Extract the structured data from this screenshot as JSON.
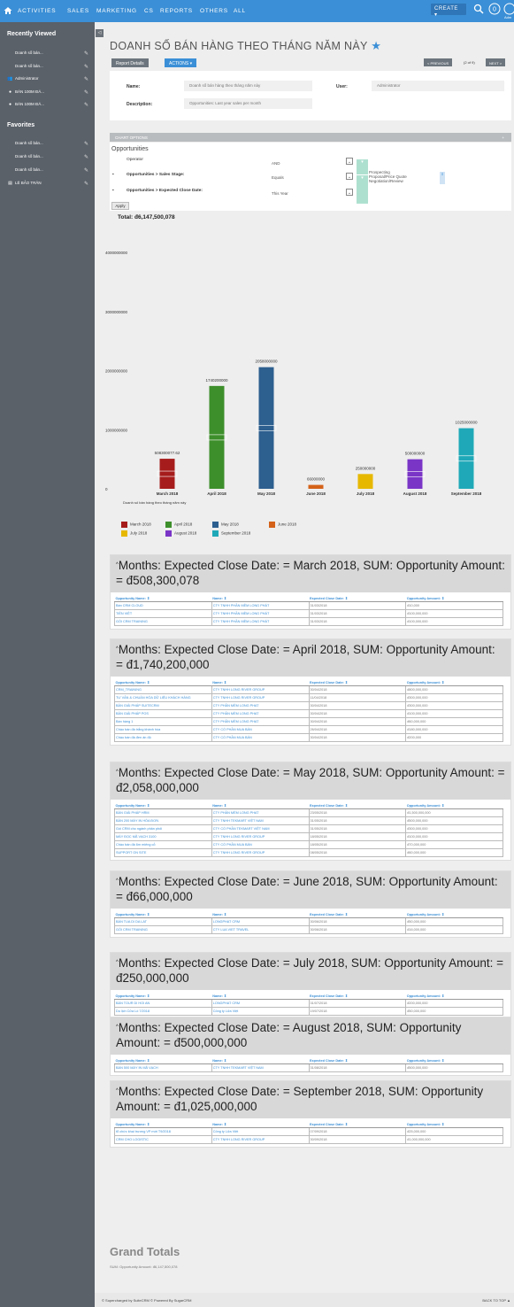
{
  "nav": {
    "items": [
      "ACTIVITIES",
      "SALES",
      "MARKETING",
      "CS",
      "REPORTS",
      "OTHERS",
      "ALL"
    ],
    "create_label": "CREATE ▾",
    "admin_label": "Adm"
  },
  "sidebar": {
    "recent_title": "Recently Viewed",
    "recent_items": [
      {
        "icon": "",
        "label": "Doanh số bán..."
      },
      {
        "icon": "",
        "label": "Doanh số bán..."
      },
      {
        "icon": "users",
        "label": "Administrator"
      },
      {
        "icon": "bulb",
        "label": "BÁN 100M ĐÁ..."
      },
      {
        "icon": "bulb",
        "label": "BÁN 100M ĐÁ..."
      }
    ],
    "fav_title": "Favorites",
    "fav_items": [
      {
        "icon": "",
        "label": "Doanh số bán..."
      },
      {
        "icon": "",
        "label": "Doanh số bán..."
      },
      {
        "icon": "",
        "label": "Doanh số bán..."
      },
      {
        "icon": "contact",
        "label": "LÊ BẢO TRÂN"
      }
    ]
  },
  "page": {
    "title": "DOANH SỐ BÁN HÀNG THEO THÁNG NĂM NÀY",
    "tab_report_details": "Report Details",
    "tab_actions": "ACTIONS ▾",
    "prev_label": "< PREVIOUS",
    "pager": "(2 of 9)",
    "next_label": "NEXT >",
    "name_label": "Name:",
    "name_value": "Doanh số bán hàng theo tháng năm này",
    "user_label": "User:",
    "user_value": "Administrator",
    "desc_label": "Description:",
    "desc_value": "Opportunities: Last year sales per month",
    "chart_options": "CHART OPTIONS",
    "chart_options_toggle": "+",
    "module": "Opportunities",
    "operator_label": "Operator",
    "operator_value": "AND",
    "cond1_label": "Opportunities > Sales Stage:",
    "cond1_op": "Equals",
    "cond1_values": [
      "Prospecting",
      "Proposal/Price Quote",
      "Negotiation/Review"
    ],
    "cond2_label": "Opportunities > Expected Close Date:",
    "cond2_op": "This Year",
    "apply": "Apply",
    "total": "Total: đ6,147,500,078"
  },
  "chart_data": {
    "type": "bar",
    "categories": [
      "March 2018",
      "April 2018",
      "May 2018",
      "June 2018",
      "July 2018",
      "August 2018",
      "September 2018"
    ],
    "values": [
      508300077.62,
      1740200000,
      2058000000,
      66000000,
      250000000,
      500000000,
      1025000000
    ],
    "value_labels": [
      "508300077.62",
      "1740200000",
      "2058000000",
      "66000000",
      "250000000",
      "500000000",
      "1025000000"
    ],
    "colors": [
      "#a61c1c",
      "#3d8f2b",
      "#2d5f8f",
      "#d4621a",
      "#e6b800",
      "#7a35c7",
      "#1fa9b8"
    ],
    "y_tick_labels": [
      "0",
      "1000000000",
      "2000000000",
      "3000000000",
      "4000000000"
    ],
    "y_ticks": [
      0,
      1000000000,
      2000000000,
      3000000000,
      4000000000
    ],
    "ylim": [
      0,
      4300000000
    ],
    "xlabel": "Doanh số bán hàng theo tháng năm này",
    "legend": [
      "March 2018",
      "April 2018",
      "May 2018",
      "June 2018",
      "July 2018",
      "August 2018",
      "September 2018"
    ]
  },
  "groups": [
    {
      "heading": "Months: Expected Close Date: = March 2018, SUM: Opportunity Amount: = đ508,300,078",
      "columns": [
        "Opportunity Name: ⇕",
        "Name: ⇕",
        "Expected Close Date: ⇕",
        "Opportunity Amount: ⇕"
      ],
      "rows": [
        [
          "Bán CRM CLOUD",
          "CTY TNHH PHẦN MỀM LONG PHÁT",
          "31/03/2018",
          "đ10,000"
        ],
        [
          "TIỀN VIỆT",
          "CTY TNHH PHẦN MỀM LONG PHÁT",
          "31/03/2018",
          "đ100,000,000"
        ],
        [
          "GÓI CRM TRAINING",
          "CTY TNHH PHẦN MỀM LONG PHÁT",
          "31/03/2018",
          "đ100,000,000"
        ]
      ]
    },
    {
      "heading": "Months: Expected Close Date: = April 2018, SUM: Opportunity Amount: = đ1,740,200,000",
      "columns": [
        "Opportunity Name: ⇕",
        "Name: ⇕",
        "Expected Close Date: ⇕",
        "Opportunity Amount: ⇕"
      ],
      "rows": [
        [
          "CRM_TRAINING",
          "CTY TNHH LONG RIVER GROUP",
          "30/04/2018",
          "đ800,000,000"
        ],
        [
          "TƯ VẤN & CHUẨN HÓA DỮ LIỆU KHÁCH HÀNG",
          "CTY TNHH LONG RIVER GROUP",
          "11/04/2018",
          "đ300,000,000"
        ],
        [
          "BẢN GIẢI PHÁP SUITECRM",
          "CTY PHẦN MỀM LONG PHAT",
          "30/04/2018",
          "đ300,000,000"
        ],
        [
          "BẢN GIẢI PHÁP POS",
          "CTY PHẦN MỀM LONG PHAT",
          "30/04/2018",
          "đ100,000,000"
        ],
        [
          "Bán hàng 1",
          "CTY PHẦN MỀM LONG PHAT",
          "30/04/2018",
          "đ60,000,000"
        ],
        [
          "Chào bán đá trắng khánh hòa",
          "CTY CỔ PHẦN MUA BÁN",
          "26/04/2018",
          "đ180,000,000"
        ],
        [
          "Chào bán đá đen ấn độ",
          "CTY CỔ PHẦN MUA BÁN",
          "30/04/2018",
          "đ200,000"
        ]
      ]
    },
    {
      "heading": "Months: Expected Close Date: = May 2018, SUM: Opportunity Amount: = đ2,058,000,000",
      "columns": [
        "Opportunity Name: ⇕",
        "Name: ⇕",
        "Expected Close Date: ⇕",
        "Opportunity Amount: ⇕"
      ],
      "rows": [
        [
          "BẢN GIẢI PHÁP HRM",
          "CTY PHẦN MỀM LONG PHAT",
          "23/05/2018",
          "đ1,500,000,000"
        ],
        [
          "BẢN 200 MÁY IN HÓA ĐƠN",
          "CTY TNHH TEKMART VIỆT NAM",
          "31/05/2018",
          "đ500,000,000"
        ],
        [
          "Gói CRM cho ngành phân phối",
          "CTY CỔ PHẦN TEKMART VIỆT NAM",
          "31/05/2018",
          "đ300,000,000"
        ],
        [
          "MÁY ĐỌC MÃ VẠCH 3100",
          "CTY TNHH LONG RIVER GROUP",
          "18/05/2018",
          "đ100,000,000"
        ],
        [
          "Chào bán đá 6m miếng cỗ",
          "CTY CỔ PHẦN MUA BÁN",
          "18/05/2018",
          "đ70,000,000"
        ],
        [
          "SUPPORT ON SITE",
          "CTY TNHH LONG RIVER GROUP",
          "08/05/2018",
          "đ60,000,000"
        ]
      ]
    },
    {
      "heading": "Months: Expected Close Date: = June 2018, SUM: Opportunity Amount: = đ66,000,000",
      "columns": [
        "Opportunity Name: ⇕",
        "Name: ⇕",
        "Expected Close Date: ⇕",
        "Opportunity Amount: ⇕"
      ],
      "rows": [
        [
          "BÁN TUA DI DA LAT",
          "LONGPHAT CRM",
          "30/06/2018",
          "đ50,000,000"
        ],
        [
          "GÓI CRM TRAINING",
          "CTY LUA VIET TRAVEL",
          "30/06/2018",
          "đ16,000,000"
        ]
      ]
    },
    {
      "heading": "Months: Expected Close Date: = July 2018, SUM: Opportunity Amount: = đ250,000,000",
      "columns": [
        "Opportunity Name: ⇕",
        "Name: ⇕",
        "Expected Close Date: ⇕",
        "Opportunity Amount: ⇕"
      ],
      "rows": [
        [
          "BÁN TOUR DI HOI AN",
          "LONGPHAT CRM",
          "31/07/2018",
          "đ200,000,000"
        ],
        [
          "Du lịch Cửa Lò 7/2018",
          "Công ty Lửa Việt",
          "19/07/2018",
          "đ50,000,000"
        ]
      ]
    },
    {
      "heading": "Months: Expected Close Date: = August 2018, SUM: Opportunity Amount: = đ500,000,000",
      "columns": [
        "Opportunity Name: ⇕",
        "Name: ⇕",
        "Expected Close Date: ⇕",
        "Opportunity Amount: ⇕"
      ],
      "rows": [
        [
          "BÁN 500 MÁY IN MÃ VẠCH",
          "CTY TNHH TEKMART VIỆT NAM",
          "31/08/2018",
          "đ500,000,000"
        ]
      ]
    },
    {
      "heading": "Months: Expected Close Date: = September 2018, SUM: Opportunity Amount: = đ1,025,000,000",
      "columns": [
        "Opportunity Name: ⇕",
        "Name: ⇕",
        "Expected Close Date: ⇕",
        "Opportunity Amount: ⇕"
      ],
      "rows": [
        [
          "tổ chức khai trương VP mới T9/2018",
          "Công ty Lửa Việt",
          "07/09/2018",
          "đ25,000,000"
        ],
        [
          "CRM CHO LOGISTIC",
          "CTY TNHH LONG RIVER GROUP",
          "30/09/2018",
          "đ1,000,000,000"
        ]
      ]
    }
  ],
  "grand": {
    "title": "Grand Totals",
    "sub": "SUM: Opportunity Amount: đ6,147,500,078"
  },
  "footer": {
    "left": "© Supercharged by SuiteCRM   © Powered By SugarCRM",
    "right": "BACK TO TOP ▲"
  }
}
